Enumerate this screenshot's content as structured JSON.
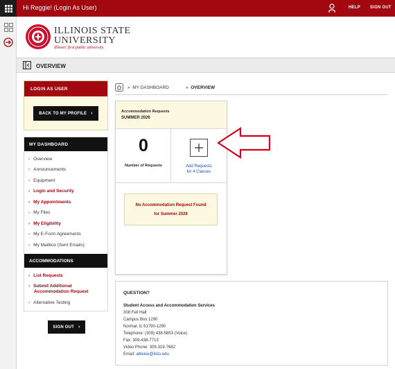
{
  "topbar": {
    "greeting": "Hi Reggie! (Login As User)",
    "help": "HELP",
    "signout": "SIGN OUT",
    "color": "#a3070f"
  },
  "logo": {
    "line1": "ILLINOIS STATE",
    "line2": "UNIVERSITY",
    "tagline": "Illinois' first public university."
  },
  "page_title": "OVERVIEW",
  "sidebar": {
    "login_as_user": {
      "header": "LOGIN AS USER",
      "button": "BACK TO MY PROFILE"
    },
    "dashboard": {
      "header": "MY DASHBOARD",
      "items": [
        {
          "label": "Overview",
          "emphasis": false
        },
        {
          "label": "Announcements",
          "emphasis": false
        },
        {
          "label": "Equipment",
          "emphasis": false
        },
        {
          "label": "Login and Security",
          "emphasis": true
        },
        {
          "label": "My Appointments",
          "emphasis": true
        },
        {
          "label": "My Files",
          "emphasis": false
        },
        {
          "label": "My Eligibility",
          "emphasis": true
        },
        {
          "label": "My E-Form Agreements",
          "emphasis": false
        },
        {
          "label": "My Mailbox (Sent Emails)",
          "emphasis": false
        }
      ]
    },
    "accommodations": {
      "header": "ACCOMMODATIONS",
      "items": [
        {
          "label": "List Requests"
        },
        {
          "label": "Submit Additional",
          "label2": "Accommodation Request"
        },
        {
          "label": "Alternative Testing"
        }
      ]
    },
    "signout_button": "SIGN OUT"
  },
  "breadcrumb": {
    "item1": "MY DASHBOARD",
    "item2": "OVERVIEW"
  },
  "request_card": {
    "title": "Accommodation Requests",
    "term": "SUMMER 2026",
    "count": "0",
    "count_label": "Number of Requests",
    "add_line1": "Add Requests",
    "add_line2": "for 4 Classes",
    "notice_line1": "No Accommodation Request Found",
    "notice_line2": "for Summer 2026"
  },
  "question": {
    "title": "QUESTION?",
    "office": "Student Access and Accommodation Services",
    "lines": [
      "308 Fell Hall",
      "Campus Box 1290",
      "Normal, IL 61790-1290",
      "Telephone: (309) 438-5853 (Voice)",
      "Fax: 309-438-7713",
      "Video Phone: 309-319-7682"
    ],
    "email_label": "Email:",
    "email": "ableisu@ilstu.edu"
  },
  "annotation_arrow_color": "#d0021b"
}
